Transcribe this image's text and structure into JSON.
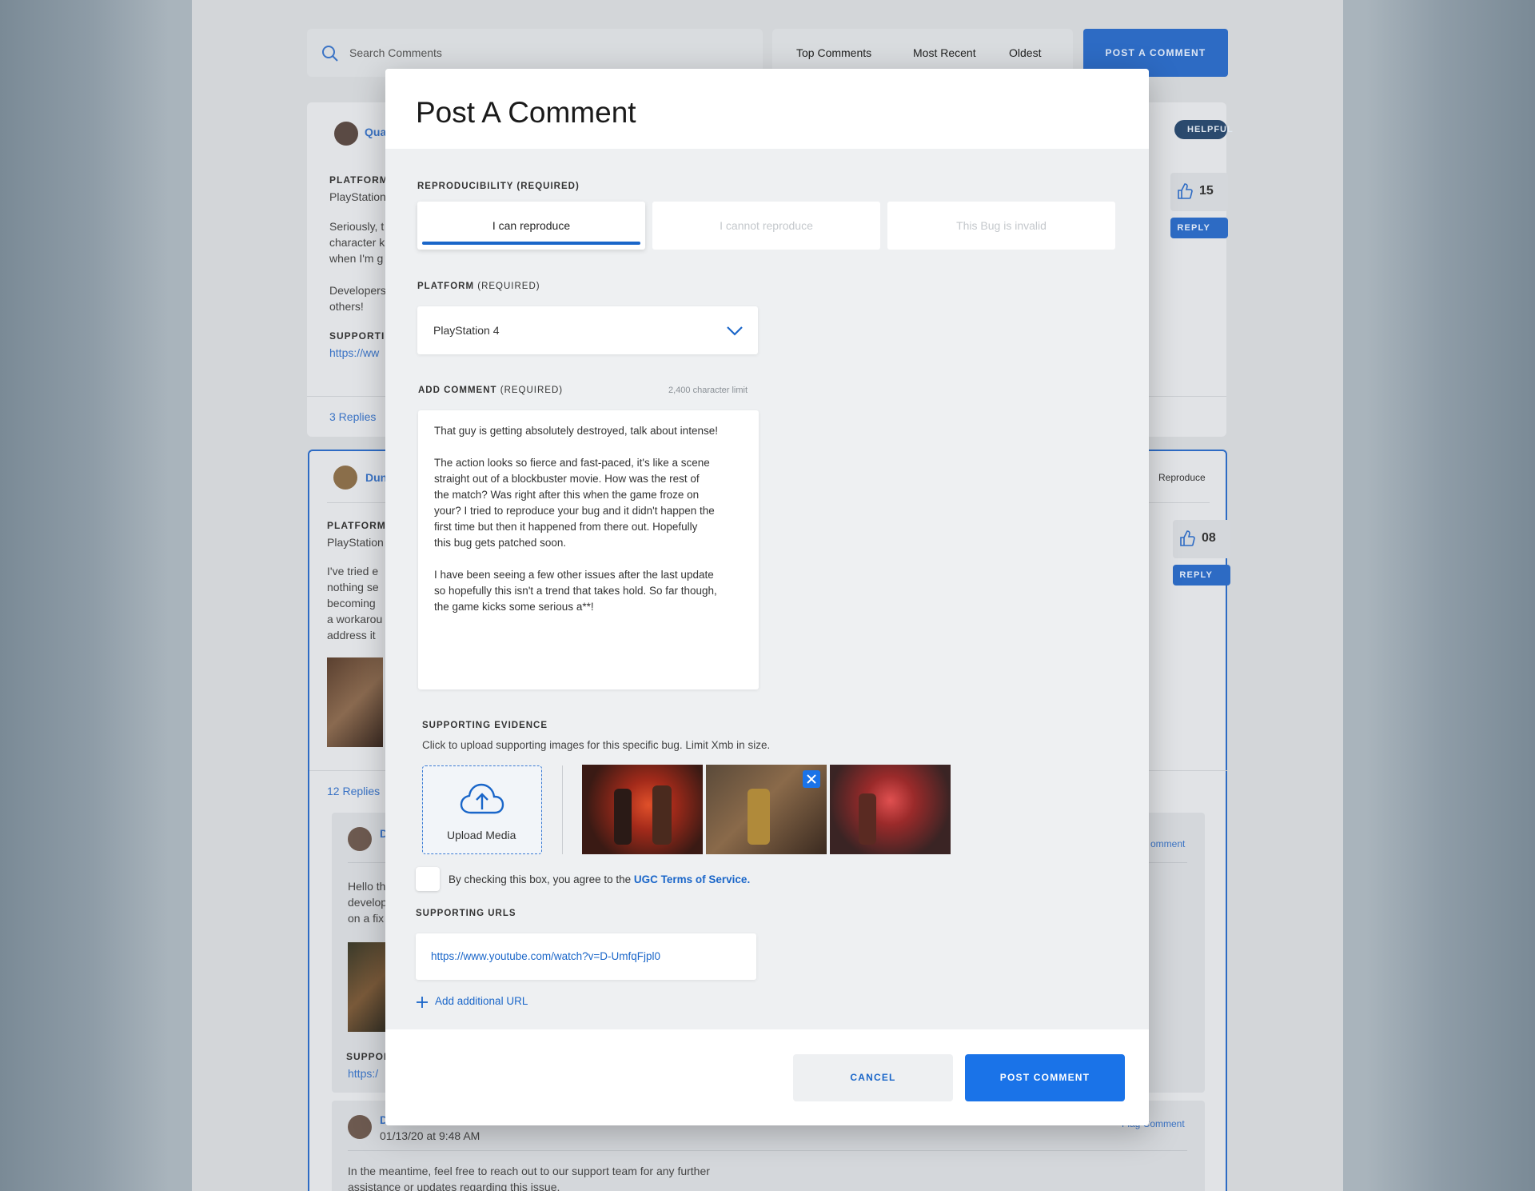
{
  "search": {
    "placeholder": "Search Comments"
  },
  "sort_tabs": [
    "Top Comments",
    "Most Recent",
    "Oldest"
  ],
  "post_comment_button": "POST A COMMENT",
  "bg_comment1": {
    "author": "Qua",
    "badge": "HELPFUL",
    "platform_label": "PLATFORM",
    "platform": "PlayStation",
    "text_lines": [
      "Seriously, t",
      "character k",
      "when I'm g",
      "",
      "Developers",
      "others!"
    ],
    "supporting_label": "SUPPORTIN",
    "url": "https://ww",
    "likes": "15",
    "reply": "REPLY",
    "replies": "3 Replies"
  },
  "bg_comment2": {
    "author": "Dun",
    "status": "Reproduce",
    "platform_label": "PLATFORM",
    "platform": "PlayStation",
    "text_lines": [
      "I've tried e",
      "nothing se",
      "becoming",
      "a workarou",
      "address it"
    ],
    "likes": "08",
    "reply": "REPLY",
    "replies": "12 Replies"
  },
  "bg_reply1": {
    "author": "D",
    "text_lines": [
      "Hello th",
      "develop",
      "on a fix"
    ],
    "flag": "omment",
    "supporting_label": "SUPPOR",
    "url": "https:/"
  },
  "bg_reply2": {
    "author": "D",
    "timestamp": "01/13/20 at 9:48 AM",
    "flag": "Flag Comment",
    "text_lines": [
      "In the meantime, feel free to reach out to our support team for any further",
      "assistance or updates regarding this issue."
    ]
  },
  "modal": {
    "title": "Post A Comment",
    "reproducibility": {
      "label": "REPRODUCIBILITY (REQUIRED)",
      "options": [
        "I can reproduce",
        "I cannot reproduce",
        "This Bug is invalid"
      ],
      "selected": "I can reproduce"
    },
    "platform": {
      "label": "PLATFORM",
      "required": "(REQUIRED)",
      "value": "PlayStation 4"
    },
    "comment": {
      "label": "ADD COMMENT",
      "required": "(REQUIRED)",
      "limit": "2,400 character limit",
      "paragraphs": [
        [
          "That guy is getting absolutely destroyed, talk about intense!"
        ],
        [
          "The action looks so fierce and fast-paced, it's like a scene",
          "straight out of a blockbuster movie. How was the rest of",
          "the match? Was right after this when the game froze on",
          "your? I tried to reproduce your bug and it didn't happen the",
          "first time but then it happened from there out. Hopefully",
          "this bug gets patched soon."
        ],
        [
          "I have been seeing a few other issues after the last update",
          "so hopefully this isn't a trend that takes hold. So far though,",
          "the game kicks some serious a**!"
        ]
      ]
    },
    "evidence": {
      "label": "SUPPORTING EVIDENCE",
      "hint": "Click to upload supporting images for this specific bug. Limit Xmb in size.",
      "upload_label": "Upload Media"
    },
    "terms": {
      "text": "By checking this box, you agree to the ",
      "link": "UGC Terms of Service."
    },
    "urls": {
      "label": "SUPPORTING URLS",
      "value": "https://www.youtube.com/watch?v=D-UmfqFjpl0",
      "add_label": "Add additional URL"
    },
    "cancel": "CANCEL",
    "submit": "POST COMMENT"
  },
  "colors": {
    "accent": "#1a73e8",
    "link": "#1a66c9"
  }
}
